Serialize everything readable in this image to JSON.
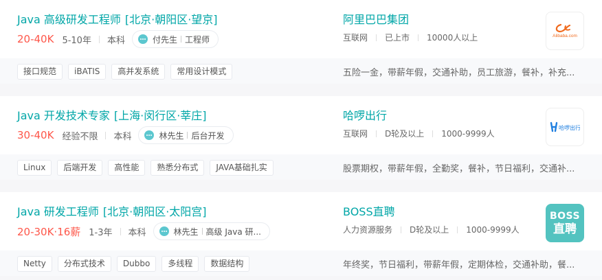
{
  "jobs": [
    {
      "title": "Java 高级研发工程师",
      "area": "[北京·朝阳区·望京]",
      "salary": "20-40K",
      "experience": "5-10年",
      "degree": "本科",
      "recruiter_name": "付先生",
      "recruiter_title": "工程师",
      "skills": [
        "接口规范",
        "iBATIS",
        "高并发系统",
        "常用设计模式"
      ],
      "welfare": "五险一金，带薪年假，交通补助，员工旅游，餐补，补充...",
      "company": {
        "name": "阿里巴巴集团",
        "industry": "互联网",
        "stage": "已上市",
        "size": "10000人以上",
        "logo_text": "Alibaba.com"
      }
    },
    {
      "title": "Java 开发技术专家",
      "area": "[上海·闵行区·莘庄]",
      "salary": "30-40K",
      "experience": "经验不限",
      "degree": "本科",
      "recruiter_name": "林先生",
      "recruiter_title": "后台开发",
      "skills": [
        "Linux",
        "后端开发",
        "高性能",
        "熟悉分布式",
        "JAVA基础扎实"
      ],
      "welfare": "股票期权，带薪年假，全勤奖，餐补，节日福利，交通补...",
      "company": {
        "name": "哈啰出行",
        "industry": "互联网",
        "stage": "D轮及以上",
        "size": "1000-9999人",
        "logo_text": "哈啰出行"
      }
    },
    {
      "title": "Java 研发工程师",
      "area": "[北京·朝阳区·太阳宫]",
      "salary": "20-30K·16薪",
      "experience": "1-3年",
      "degree": "本科",
      "recruiter_name": "林先生",
      "recruiter_title": "高级 Java 研...",
      "skills": [
        "Netty",
        "分布式技术",
        "Dubbo",
        "多线程",
        "数据结构"
      ],
      "welfare": "年终奖，节日福利，带薪年假，定期体检，交通补助，餐...",
      "company": {
        "name": "BOSS直聘",
        "industry": "人力资源服务",
        "stage": "D轮及以上",
        "size": "1000-9999人",
        "logo_line1": "BOSS",
        "logo_line2": "直聘"
      }
    }
  ]
}
